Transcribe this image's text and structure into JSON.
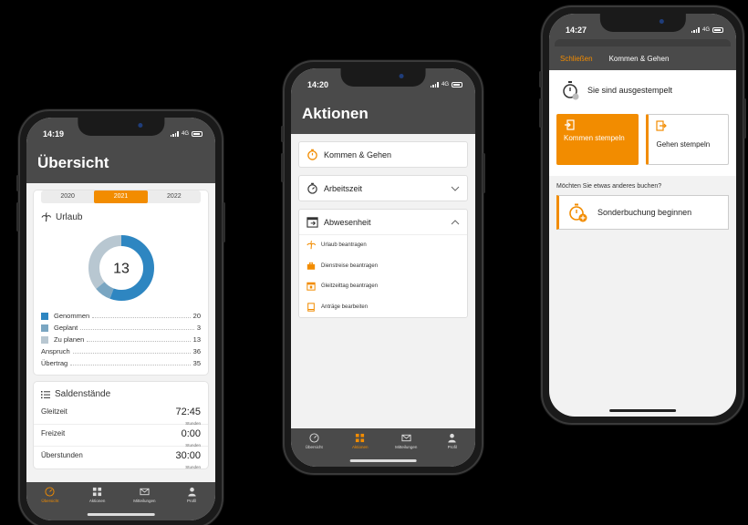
{
  "colors": {
    "accent": "#f28c00",
    "dark": "#4a4a4a",
    "genommen": "#2e86c1",
    "geplant": "#7aa6c2",
    "zu_planen": "#b8c7d1"
  },
  "phone1": {
    "time": "14:19",
    "network": "4G",
    "title": "Übersicht",
    "years": [
      "2020",
      "2021",
      "2022"
    ],
    "active_year": "2021",
    "urlaub_label": "Urlaub",
    "donut_center": "13",
    "chart_data": {
      "type": "pie",
      "categories": [
        "Genommen",
        "Geplant",
        "Zu planen"
      ],
      "values": [
        20,
        3,
        13
      ]
    },
    "legend": [
      {
        "label": "Genommen",
        "value": "20",
        "color": "#2e86c1"
      },
      {
        "label": "Geplant",
        "value": "3",
        "color": "#7aa6c2"
      },
      {
        "label": "Zu planen",
        "value": "13",
        "color": "#b8c7d1"
      }
    ],
    "extra": [
      {
        "label": "Anspruch",
        "value": "36"
      },
      {
        "label": "Übertrag",
        "value": "35"
      }
    ],
    "saldo_title": "Saldenstände",
    "balances": [
      {
        "label": "Gleitzeit",
        "value": "72:45",
        "unit": "Stunden"
      },
      {
        "label": "Freizeit",
        "value": "0:00",
        "unit": "Stunden"
      },
      {
        "label": "Überstunden",
        "value": "30:00",
        "unit": "Stunden"
      }
    ],
    "tabs": [
      "Übersicht",
      "Aktionen",
      "Mitteilungen",
      "Profil"
    ],
    "active_tab": "Übersicht"
  },
  "phone2": {
    "time": "14:20",
    "network": "4G",
    "title": "Aktionen",
    "sections": [
      {
        "label": "Kommen & Gehen",
        "icon": "stopwatch-icon"
      },
      {
        "label": "Arbeitszeit",
        "icon": "timer-icon",
        "state": "collapsed"
      },
      {
        "label": "Abwesenheit",
        "icon": "calendar-exit-icon",
        "state": "expanded"
      }
    ],
    "absence_items": [
      {
        "label": "Urlaub beantragen",
        "icon": "palm-tree-icon"
      },
      {
        "label": "Dienstreise beantragen",
        "icon": "briefcase-icon"
      },
      {
        "label": "Gleitzeittag beantragen",
        "icon": "calendar-day-icon"
      },
      {
        "label": "Anträge bearbeiten",
        "icon": "document-edit-icon"
      }
    ],
    "tabs": [
      "Übersicht",
      "Aktionen",
      "Mitteilungen",
      "Profil"
    ],
    "active_tab": "Aktionen"
  },
  "phone3": {
    "time": "14:27",
    "network": "4G",
    "close_label": "Schließen",
    "nav_title": "Kommen & Gehen",
    "state_text": "Sie sind ausgestempelt",
    "kommen_label": "Kommen stempeln",
    "gehen_label": "Gehen stempeln",
    "question": "Möchten Sie etwas anderes buchen?",
    "sonder_label": "Sonderbuchung beginnen"
  }
}
